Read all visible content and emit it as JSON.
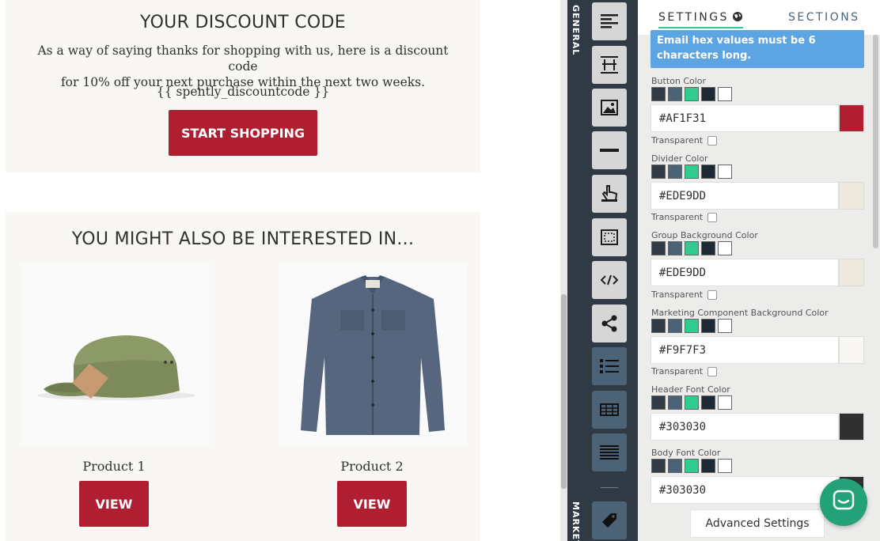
{
  "email": {
    "discount": {
      "title": "YOUR DISCOUNT CODE",
      "body_line1": "As a way of saying thanks for shopping with us, here is a discount code",
      "body_line2": "for 10% off your next purchase within the next two weeks.",
      "code_token": "{{ spently_discountcode }}",
      "cta_label": "START SHOPPING"
    },
    "products": {
      "title": "YOU MIGHT ALSO BE INTERESTED IN...",
      "items": [
        {
          "name": "Product 1",
          "cta": "VIEW",
          "image_icon": "green-cap-image"
        },
        {
          "name": "Product 2",
          "cta": "VIEW",
          "image_icon": "denim-shirt-image"
        }
      ]
    },
    "colors": {
      "button": "#af1f31",
      "card_bg": "#f9f7f3",
      "text": "#303030"
    }
  },
  "side_tabs": {
    "general": "GENERAL",
    "marketing": "MARKETING"
  },
  "tools": [
    "text-align-icon",
    "spacer-icon",
    "image-icon",
    "divider-icon",
    "pointer-hand-icon",
    "dotted-frame-icon",
    "code-icon",
    "share-icon",
    "list-icon",
    "table-icon",
    "lines-icon",
    "tag-icon"
  ],
  "panel": {
    "tab_settings": "SETTINGS",
    "tab_sections": "SECTIONS",
    "alert_text": "Email hex values must be 6 characters long.",
    "transparent_label": "Transparent",
    "fields": [
      {
        "label": "Button Color",
        "value": "#AF1F31",
        "preview": "#af1f31",
        "transparent": true
      },
      {
        "label": "Divider Color",
        "value": "#EDE9DD",
        "preview": "#ede9dd",
        "transparent": true
      },
      {
        "label": "Group Background Color",
        "value": "#EDE9DD",
        "preview": "#ede9dd",
        "transparent": true
      },
      {
        "label": "Marketing Component Background Color",
        "value": "#F9F7F3",
        "preview": "#f9f7f3",
        "transparent": true
      },
      {
        "label": "Header Font Color",
        "value": "#303030",
        "preview": "#303030",
        "transparent": false
      },
      {
        "label": "Body Font Color",
        "value": "#303030",
        "preview": "#303030",
        "transparent": false
      }
    ],
    "advanced_label": "Advanced Settings"
  },
  "chat": {
    "icon": "chat-icon"
  }
}
